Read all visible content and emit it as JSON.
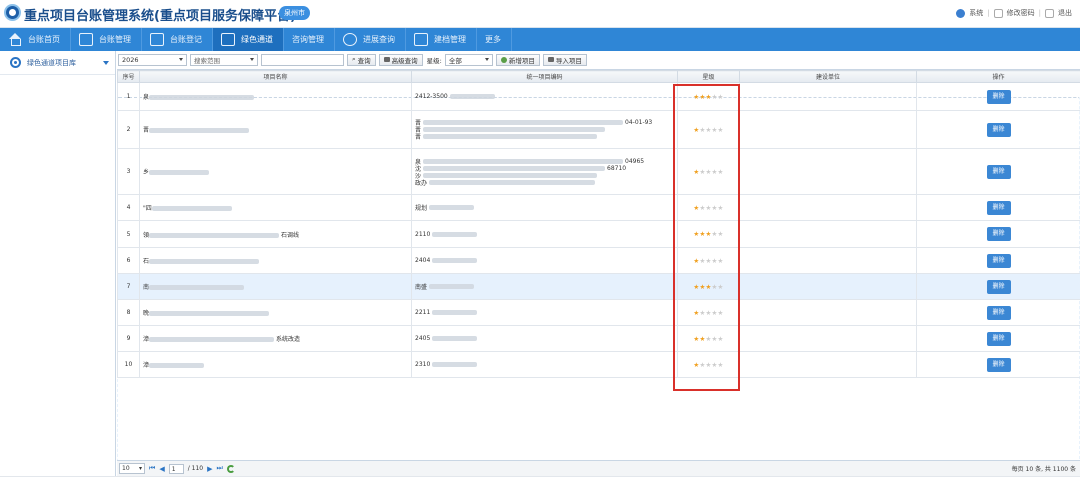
{
  "header": {
    "app_title": "重点项目台账管理系统(重点项目服务保障平台)",
    "city": "泉州市",
    "user_label": "系统",
    "change_password": "修改密码",
    "logout": "退出"
  },
  "nav": [
    {
      "label": "台账首页"
    },
    {
      "label": "台账管理"
    },
    {
      "label": "台账登记"
    },
    {
      "label": "绿色通道"
    },
    {
      "label": "咨询管理"
    },
    {
      "label": "进展查询"
    },
    {
      "label": "建档管理"
    },
    {
      "label": "更多"
    }
  ],
  "sidebar": {
    "items": [
      {
        "label": "绿色通道项目库"
      }
    ]
  },
  "toolbar": {
    "year": "2026",
    "scope_placeholder": "搜索范围",
    "search_btn": "查询",
    "advanced_btn": "高级查询",
    "star_label": "星级:",
    "star_value": "全部",
    "add_btn": "新增项目",
    "import_btn": "导入项目"
  },
  "table": {
    "headers": [
      "序号",
      "项目名称",
      "统一项目编码",
      "星级",
      "建设单位",
      "操作"
    ],
    "rows": [
      {
        "no": "1",
        "name_visible": "泉",
        "name_suffix": "",
        "codes": [
          "2412-3500"
        ],
        "stars": 3,
        "op": "删除"
      },
      {
        "no": "2",
        "name_visible": "晋",
        "name_suffix": "",
        "codes": [
          "晋",
          "晋",
          "晋"
        ],
        "code_suffix": "04-01-93",
        "stars": 1,
        "op": "删除"
      },
      {
        "no": "3",
        "name_visible": "乡",
        "name_suffix": "",
        "codes": [
          "泉",
          "沈",
          "沙",
          "政办"
        ],
        "code_suffix": "04965",
        "code_suffix2": "68710",
        "stars": 1,
        "op": "删除"
      },
      {
        "no": "4",
        "name_visible": "\"四",
        "name_suffix": "",
        "codes": [
          "规划"
        ],
        "stars": 1,
        "op": "删除"
      },
      {
        "no": "5",
        "name_visible": "領",
        "name_suffix": "石调线",
        "codes": [
          "2110"
        ],
        "stars": 3,
        "op": "删除"
      },
      {
        "no": "6",
        "name_visible": "石",
        "name_suffix": "",
        "codes": [
          "2404"
        ],
        "stars": 1,
        "op": "删除"
      },
      {
        "no": "7",
        "name_visible": "南",
        "name_suffix": "",
        "codes": [
          "南盛"
        ],
        "stars": 3,
        "op": "删除"
      },
      {
        "no": "8",
        "name_visible": "晚",
        "name_suffix": "",
        "codes": [
          "2211"
        ],
        "stars": 1,
        "op": "删除"
      },
      {
        "no": "9",
        "name_visible": "漳",
        "name_suffix": "系统改造",
        "codes": [
          "2405"
        ],
        "stars": 2,
        "op": "删除"
      },
      {
        "no": "10",
        "name_visible": "漳",
        "name_suffix": "",
        "codes": [
          "2310"
        ],
        "stars": 1,
        "op": "删除"
      }
    ]
  },
  "pager": {
    "page_size": "10",
    "current_page": "1",
    "total_pages": "/ 110",
    "info": "每页 10 条, 共 1100 条"
  }
}
